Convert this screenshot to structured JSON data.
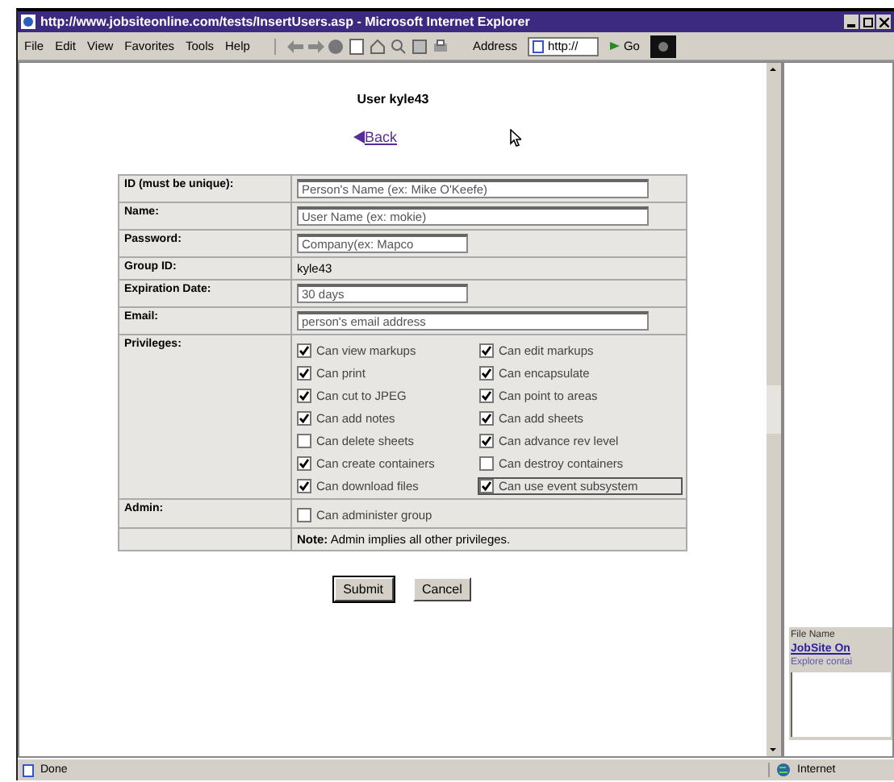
{
  "window": {
    "title": "http://www.jobsiteonline.com/tests/InsertUsers.asp - Microsoft Internet Explorer"
  },
  "menu": [
    "File",
    "Edit",
    "View",
    "Favorites",
    "Tools",
    "Help"
  ],
  "address": {
    "label": "Address",
    "value": "http://",
    "go": "Go"
  },
  "page": {
    "heading": "User kyle43",
    "back_link": "Back",
    "rows": [
      {
        "kind": "text",
        "label": "ID (must be unique):",
        "value": "Person's Name (ex: Mike O'Keefe)",
        "wide": true
      },
      {
        "kind": "text",
        "label": "Name:",
        "value": "User Name (ex: mokie)",
        "wide": true
      },
      {
        "kind": "text",
        "label": "Password:",
        "value": "Company(ex: Mapco",
        "wide": false
      },
      {
        "kind": "static",
        "label": "Group ID:",
        "value": "kyle43"
      },
      {
        "kind": "text",
        "label": "Expiration Date:",
        "value": "30 days",
        "wide": false
      },
      {
        "kind": "text",
        "label": "Email:",
        "value": "person's email address",
        "wide": true
      },
      {
        "kind": "checks",
        "label": "Privileges:",
        "checks": [
          {
            "label": "Can view markups",
            "checked": true,
            "focused": false
          },
          {
            "label": "Can edit markups",
            "checked": true,
            "focused": false
          },
          {
            "label": "Can print",
            "checked": true,
            "focused": false
          },
          {
            "label": "Can encapsulate",
            "checked": true,
            "focused": false
          },
          {
            "label": "Can cut to JPEG",
            "checked": true,
            "focused": false
          },
          {
            "label": "Can point to areas",
            "checked": true,
            "focused": false
          },
          {
            "label": "Can add notes",
            "checked": true,
            "focused": false
          },
          {
            "label": "Can add sheets",
            "checked": true,
            "focused": false
          },
          {
            "label": "Can delete sheets",
            "checked": false,
            "focused": false
          },
          {
            "label": "Can advance rev level",
            "checked": true,
            "focused": false
          },
          {
            "label": "Can create containers",
            "checked": true,
            "focused": false
          },
          {
            "label": "Can destroy containers",
            "checked": false,
            "focused": false
          },
          {
            "label": "Can download files",
            "checked": true,
            "focused": false
          },
          {
            "label": "Can use event subsystem",
            "checked": true,
            "focused": true
          }
        ]
      },
      {
        "kind": "checks",
        "label": "Admin:",
        "checks": [
          {
            "label": "Can administer group",
            "checked": false,
            "focused": false
          }
        ]
      },
      {
        "kind": "note",
        "label": "",
        "value": "**Note:** Admin implies all other privileges."
      }
    ],
    "buttons": [
      "Submit",
      "Cancel"
    ]
  },
  "side_pane": {
    "column": "File Name",
    "link": "JobSite On",
    "item": "Explore contai"
  },
  "status_bar": {
    "left": "Done",
    "zone": "Internet"
  }
}
